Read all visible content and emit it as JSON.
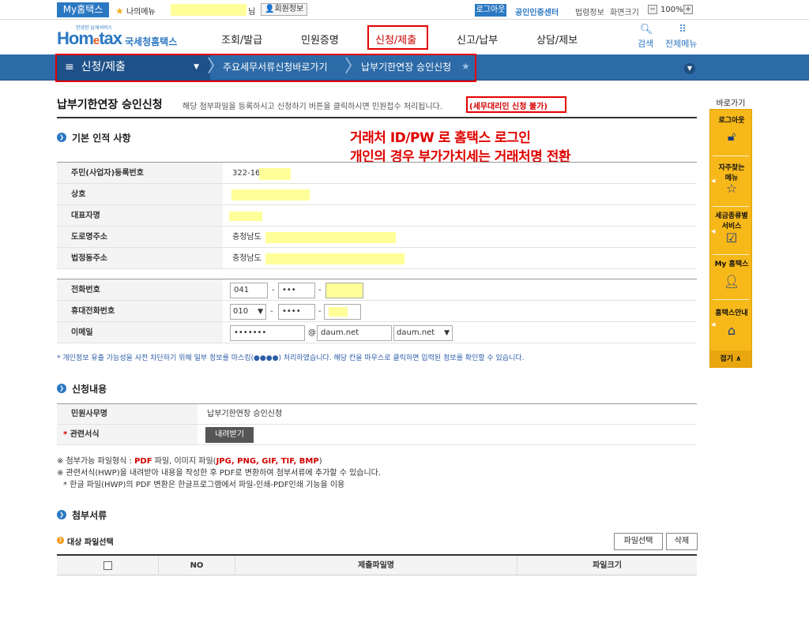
{
  "util": {
    "my_home": "My홈택스",
    "my_menu": "나의메뉴",
    "name_suffix": "님",
    "member_info": "회원정보",
    "logout": "로그아웃",
    "cert_center": "공인인증센터",
    "law_info": "법령정보",
    "screen_size": "화면크기",
    "zoom": "100%"
  },
  "header": {
    "logo_tagline": "안녕한 납세서비스",
    "logo_brand_a": "Hom",
    "logo_brand_e": "e",
    "logo_brand_b": "tax",
    "logo_nts": "국세청홈택스",
    "nav": [
      "조회/발급",
      "민원증명",
      "신청/제출",
      "신고/납부",
      "상담/제보"
    ],
    "search": "검색",
    "all_menu": "전체메뉴"
  },
  "subbar": {
    "current": "신청/제출",
    "crumb1": "주요세무서류신청바로가기",
    "crumb2": "납부기한연장 승인신청"
  },
  "page": {
    "title": "납부기한연장 승인신청",
    "desc": "해당 첨부파일을 등록하시고 신청하기 버튼을 클릭하시면 민원접수 처리됩니다.",
    "desc_red": "(세무대리인 신청 불가)"
  },
  "annotation": {
    "line1": "거래처  ID/PW 로 홈택스 로그인",
    "line2": "개인의 경우 부가가치세는 거래처명 전환"
  },
  "basic": {
    "section": "기본 인적 사항",
    "rows": [
      {
        "label": "주민(사업자)등록번호",
        "value": "322-16"
      },
      {
        "label": "상호",
        "value": ""
      },
      {
        "label": "대표자명",
        "value": ""
      },
      {
        "label": "도로명주소",
        "value": "충청남도"
      },
      {
        "label": "법정동주소",
        "value": "충청남도"
      }
    ]
  },
  "contact": {
    "phone_label": "전화번호",
    "phone1": "041",
    "phone2": "•••",
    "mobile_label": "휴대전화번호",
    "mobile1": "010",
    "mobile2": "••••",
    "email_label": "이메일",
    "email_id": "•••••••",
    "at": "@",
    "email_domain": "daum.net",
    "email_select": "daum.net",
    "dash": "-"
  },
  "notice": "* 개인정보 유출 가능성을 사전 차단하기 위해 일부 정보를 마스킹(●●●●) 처리하였습니다. 해당 칸을 마우스로 클릭하면 입력된 정보를 확인할 수 있습니다.",
  "apply": {
    "section": "신청내용",
    "name_label": "민원사무명",
    "name_value": "납부기한연장 승인신청",
    "form_label": "관련서식",
    "required_mark": "*",
    "download": "내려받기"
  },
  "notes": {
    "line1_a": "※ 첨부가능 파일형식 : ",
    "line1_pdf": "PDF",
    "line1_b": " 파일, 이미지 파일(",
    "line1_types": "JPG, PNG, GIF, TIF, BMP",
    "line1_c": ")",
    "line2": "※ 관련서식(HWP)을 내려받아 내용을 작성한 후 PDF로 변환하여 첨부서류에 추가할 수 있습니다.",
    "line3": "* 한글 파일(HWP)의 PDF 변환은 한글프로그램에서 파일-인쇄-PDF인쇄 기능을 이용"
  },
  "attach": {
    "section": "첨부서류",
    "sub": "대상 파일선택",
    "select_btn": "파일선택",
    "delete_btn": "삭제",
    "columns": [
      "NO",
      "제출파일명",
      "파일크기"
    ]
  },
  "quick": {
    "title": "바로가기",
    "items": [
      "로그아웃",
      "자주찾는 메뉴",
      "세금종류별 서비스",
      "My 홈택스",
      "홈택스안내"
    ],
    "fold": "접기 ∧"
  }
}
